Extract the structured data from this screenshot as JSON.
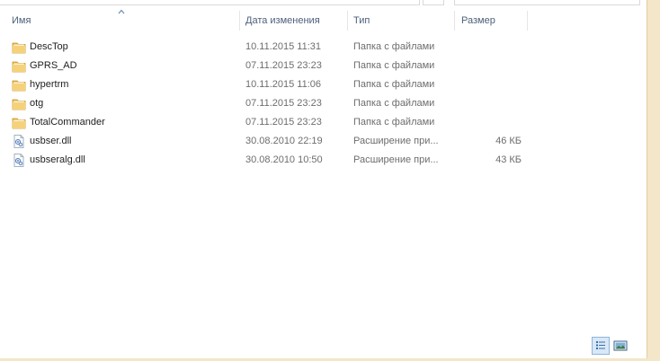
{
  "columns": {
    "name": "Имя",
    "date": "Дата изменения",
    "type": "Тип",
    "size": "Размер"
  },
  "files": [
    {
      "name": "DescTop",
      "date": "10.11.2015 11:31",
      "type": "Папка с файлами",
      "size": "",
      "icon": "folder-icon"
    },
    {
      "name": "GPRS_AD",
      "date": "07.11.2015 23:23",
      "type": "Папка с файлами",
      "size": "",
      "icon": "folder-icon"
    },
    {
      "name": "hypertrm",
      "date": "10.11.2015 11:06",
      "type": "Папка с файлами",
      "size": "",
      "icon": "folder-icon"
    },
    {
      "name": "otg",
      "date": "07.11.2015 23:23",
      "type": "Папка с файлами",
      "size": "",
      "icon": "folder-icon"
    },
    {
      "name": "TotalCommander",
      "date": "07.11.2015 23:23",
      "type": "Папка с файлами",
      "size": "",
      "icon": "folder-icon"
    },
    {
      "name": "usbser.dll",
      "date": "30.08.2010 22:19",
      "type": "Расширение при...",
      "size": "46 КБ",
      "icon": "dll-file-icon"
    },
    {
      "name": "usbseralg.dll",
      "date": "30.08.2010 10:50",
      "type": "Расширение при...",
      "size": "43 КБ",
      "icon": "dll-file-icon"
    }
  ],
  "view_buttons": {
    "details": "details-view-icon",
    "tiles": "large-icons-view-icon"
  },
  "colors": {
    "header_text": "#4c607a",
    "secondary_text": "#6d6d6d",
    "frame": "#f3e6c9",
    "selected_view": "#d9e8f7"
  }
}
